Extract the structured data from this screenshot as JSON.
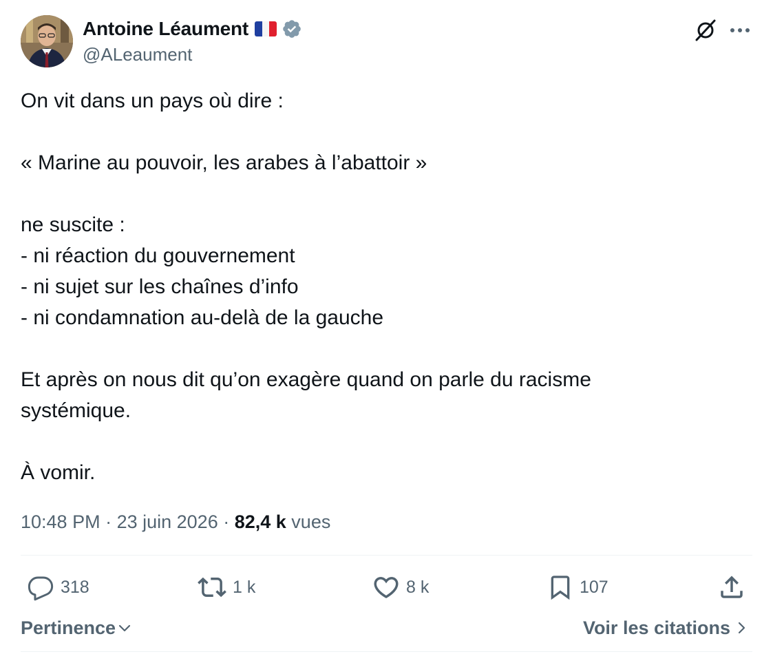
{
  "author": {
    "display_name": "Antoine Léaument",
    "handle": "@ALeaument",
    "flag_icon": "france-flag-icon",
    "verified_icon": "verified-badge-icon",
    "verified_color": "#829aab"
  },
  "tweet": {
    "lines": [
      "On vit dans un pays où dire :",
      "",
      "« Marine au pouvoir, les arabes à l’abattoir »",
      "",
      "ne suscite :",
      "- ni réaction du gouvernement",
      "- ni sujet sur les chaînes d’info",
      "- ni condamnation au-delà de la gauche",
      "",
      "Et après on nous dit qu’on exagère quand on parle du racisme",
      "systémique.",
      "",
      "À vomir."
    ]
  },
  "meta": {
    "time": "10:48 PM",
    "separator": " · ",
    "date": "23 juin 2026",
    "views_count": "82,4 k",
    "views_label": " vues"
  },
  "actions": {
    "replies": "318",
    "reposts": "1 k",
    "likes": "8 k",
    "bookmarks": "107"
  },
  "footer": {
    "sort_label": "Pertinence",
    "quotes_label": "Voir les citations"
  },
  "colors": {
    "text": "#0f1419",
    "secondary": "#536471",
    "divider": "#eff3f4"
  }
}
